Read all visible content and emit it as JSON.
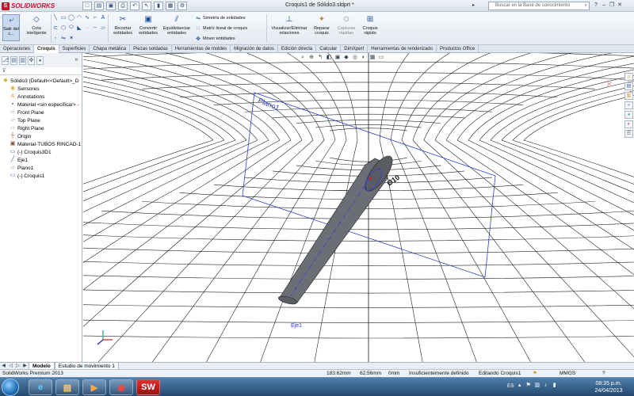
{
  "app": {
    "logo_text": "SOLIDWORKS",
    "logo_mark": "S"
  },
  "titlebar": {
    "doc_title": "Croquis1 de Sólido3.sldprt *",
    "help_search_placeholder": "Buscar en la Base de conocimiento"
  },
  "ribbon": {
    "exit_sketch_label": "Salir del c...",
    "smart_dim_label": "Cota inteligente",
    "trim_label": "Recortar entidades",
    "convert_label": "Convertir entidades",
    "offset_label": "Equidistanciar entidades",
    "mirror_label": "Simetría de entidades",
    "pattern_label": "Matriz lineal de croquis",
    "move_label": "Mover entidades",
    "relations_label": "Visualizar/Eliminar relaciones",
    "repair_label": "Reparar croquis",
    "capture_label": "Capturas rápidas",
    "quick_snaps_label": "Croquis rápido"
  },
  "command_tabs": [
    "Operaciones",
    "Croquis",
    "Superficies",
    "Chapa metálica",
    "Piezas soldadas",
    "Herramientas de moldes",
    "Migración de datos",
    "Edición directa",
    "Calcular",
    "DimXpert",
    "Herramientas de renderizado",
    "Productos Office"
  ],
  "active_command_tab": "Croquis",
  "feature_tree": {
    "items": [
      {
        "label": "Sólido3  (Default<<Default>_D",
        "icon": "part-icon",
        "color": "#d9b23a"
      },
      {
        "label": "Sensores",
        "icon": "sensor-icon",
        "color": "#e2b13a"
      },
      {
        "label": "Annotations",
        "icon": "annotations-icon",
        "color": "#d99a2a"
      },
      {
        "label": "Material <sin especificar> -",
        "icon": "material-icon",
        "color": "#6a6a6a"
      },
      {
        "label": "Front Plane",
        "icon": "plane-icon",
        "color": "#8aa0c0"
      },
      {
        "label": "Top Plane",
        "icon": "plane-icon",
        "color": "#8aa0c0"
      },
      {
        "label": "Right Plane",
        "icon": "plane-icon",
        "color": "#8aa0c0"
      },
      {
        "label": "Origin",
        "icon": "origin-icon",
        "color": "#c0392b"
      },
      {
        "label": "Material-TUBOS RINCAD-1",
        "icon": "feature-icon",
        "color": "#7a4a2a"
      },
      {
        "label": "(-) Croquis3D1",
        "icon": "sketch3d-icon",
        "color": "#4a6fa5"
      },
      {
        "label": "Eje1",
        "icon": "axis-icon",
        "color": "#4a6fa5"
      },
      {
        "label": "Plano1",
        "icon": "plane-icon",
        "color": "#8aa0c0"
      },
      {
        "label": "(-) Croquis1",
        "icon": "sketch-icon",
        "color": "#4a6fa5"
      }
    ]
  },
  "viewport": {
    "plane_label": "Plano1",
    "axis_label": "Eje1",
    "dimension_label": "Ø10"
  },
  "bottom_tabs": [
    "Modelo",
    "Estudio de movimiento 1"
  ],
  "status": {
    "product": "SolidWorks Premium 2013",
    "x": "183.62mm",
    "y": "62.56mm",
    "z": "0mm",
    "definition": "Insuficientemente definido",
    "editing": "Editando Croquis1",
    "units": "MMGS",
    "help": "?"
  },
  "taskbar": {
    "locale": "ES",
    "time": "08:35 p.m.",
    "date": "24/04/2013"
  }
}
